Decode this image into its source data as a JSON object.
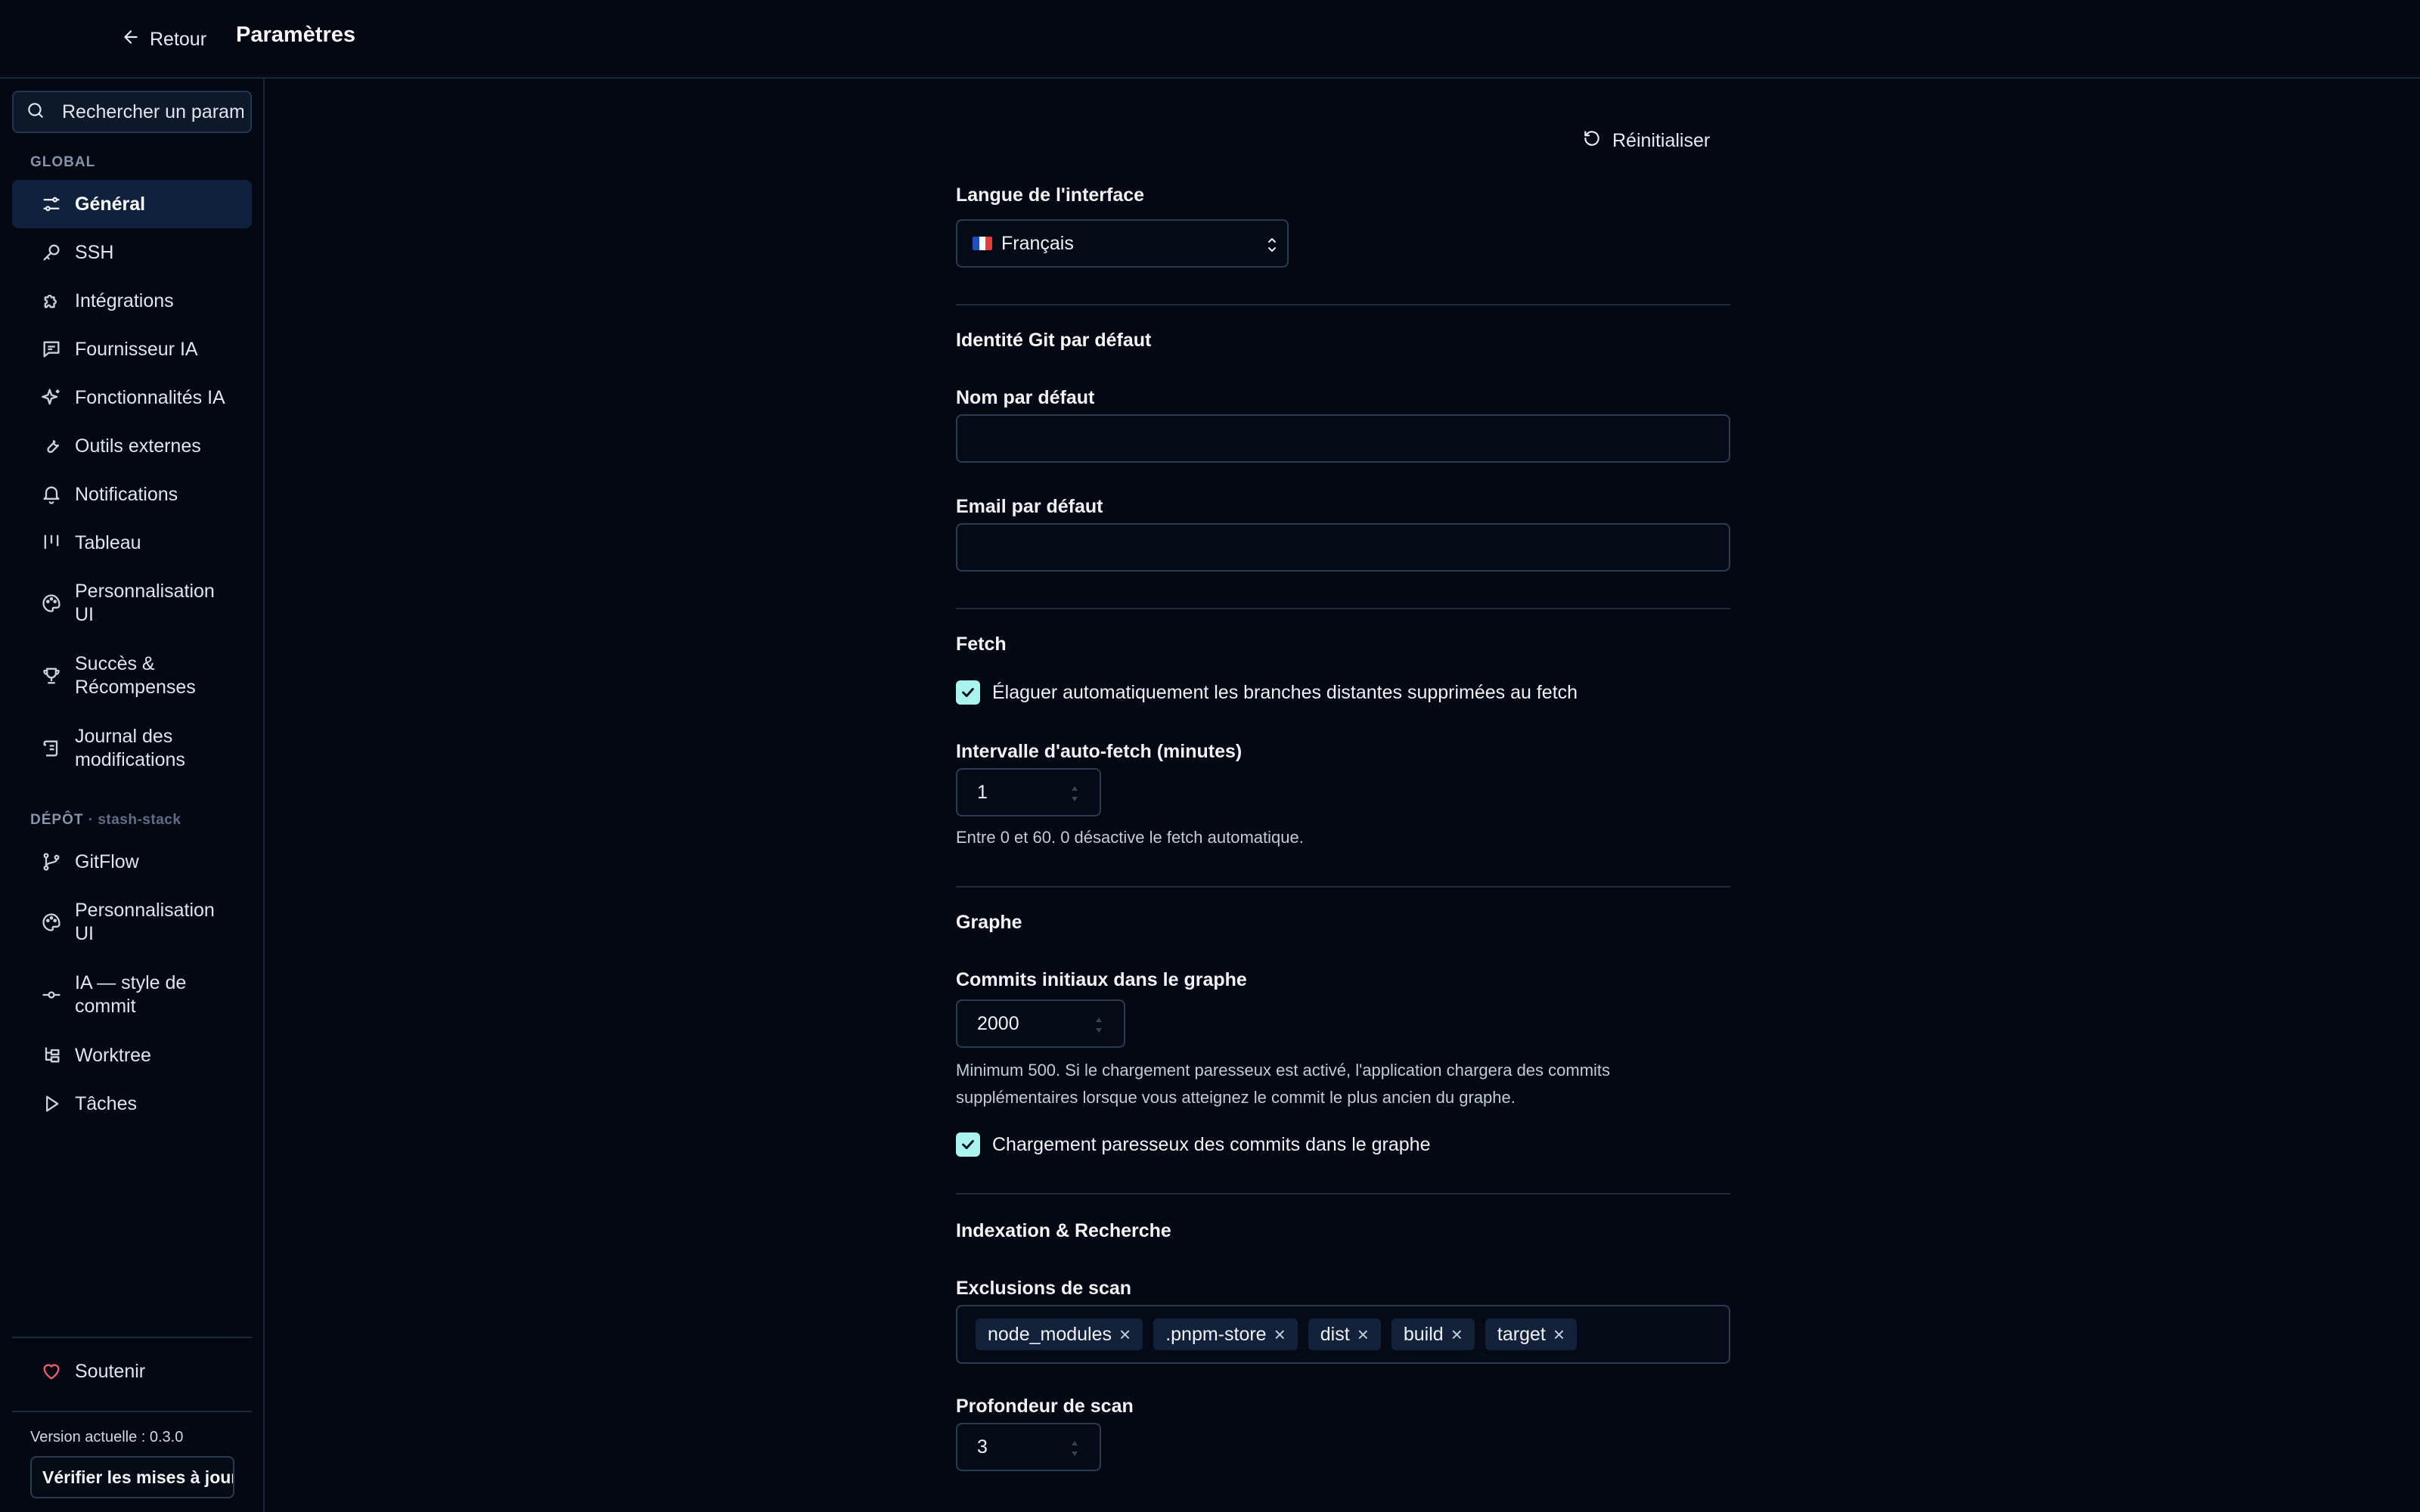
{
  "header": {
    "back_label": "Retour",
    "title": "Paramètres"
  },
  "sidebar": {
    "search_placeholder": "Rechercher un paramètre",
    "global_label": "GLOBAL",
    "global_items": [
      {
        "label": "Général",
        "icon": "sliders-icon",
        "active": true
      },
      {
        "label": "SSH",
        "icon": "key-icon"
      },
      {
        "label": "Intégrations",
        "icon": "puzzle-icon"
      },
      {
        "label": "Fournisseur IA",
        "icon": "message-icon"
      },
      {
        "label": "Fonctionnalités IA",
        "icon": "sparkles-icon"
      },
      {
        "label": "Outils externes",
        "icon": "wrench-icon"
      },
      {
        "label": "Notifications",
        "icon": "bell-icon"
      },
      {
        "label": "Tableau",
        "icon": "columns-icon"
      },
      {
        "label": "Personnalisation UI",
        "icon": "palette-icon"
      },
      {
        "label": "Succès & Récompenses",
        "icon": "trophy-icon"
      },
      {
        "label": "Journal des modifications",
        "icon": "scroll-icon"
      }
    ],
    "repo_label": "DÉPÔT",
    "repo_name": "· stash-stack",
    "repo_items": [
      {
        "label": "GitFlow",
        "icon": "git-branch-icon"
      },
      {
        "label": "Personnalisation UI",
        "icon": "palette-icon"
      },
      {
        "label": "IA — style de commit",
        "icon": "git-commit-icon"
      },
      {
        "label": "Worktree",
        "icon": "worktree-icon"
      },
      {
        "label": "Tâches",
        "icon": "play-icon"
      }
    ],
    "support_label": "Soutenir",
    "version_text": "Version actuelle : 0.3.0",
    "update_button": "Vérifier les mises à jour"
  },
  "main": {
    "reset_label": "Réinitialiser",
    "language": {
      "label": "Langue de l'interface",
      "value": "Français"
    },
    "git_identity": {
      "heading": "Identité Git par défaut",
      "name_label": "Nom par défaut",
      "name_value": "",
      "email_label": "Email par défaut",
      "email_value": ""
    },
    "fetch": {
      "heading": "Fetch",
      "prune_label": "Élaguer automatiquement les branches distantes supprimées au fetch",
      "prune_checked": true,
      "interval_label": "Intervalle d'auto-fetch (minutes)",
      "interval_value": "1",
      "interval_help": "Entre 0 et 60. 0 désactive le fetch automatique."
    },
    "graph": {
      "heading": "Graphe",
      "commits_label": "Commits initiaux dans le graphe",
      "commits_value": "2000",
      "commits_help": "Minimum 500. Si le chargement paresseux est activé, l'application chargera des commits supplémentaires lorsque vous atteignez le commit le plus ancien du graphe.",
      "lazy_label": "Chargement paresseux des commits dans le graphe",
      "lazy_checked": true
    },
    "indexing": {
      "heading": "Indexation & Recherche",
      "exclusions_label": "Exclusions de scan",
      "exclusions": [
        "node_modules",
        ".pnpm-store",
        "dist",
        "build",
        "target"
      ],
      "depth_label": "Profondeur de scan",
      "depth_value": "3"
    }
  },
  "colors": {
    "background": "#030812",
    "accent_check": "#a9f4ee",
    "active_nav": "#0f213d",
    "heart": "#f05a6e"
  }
}
